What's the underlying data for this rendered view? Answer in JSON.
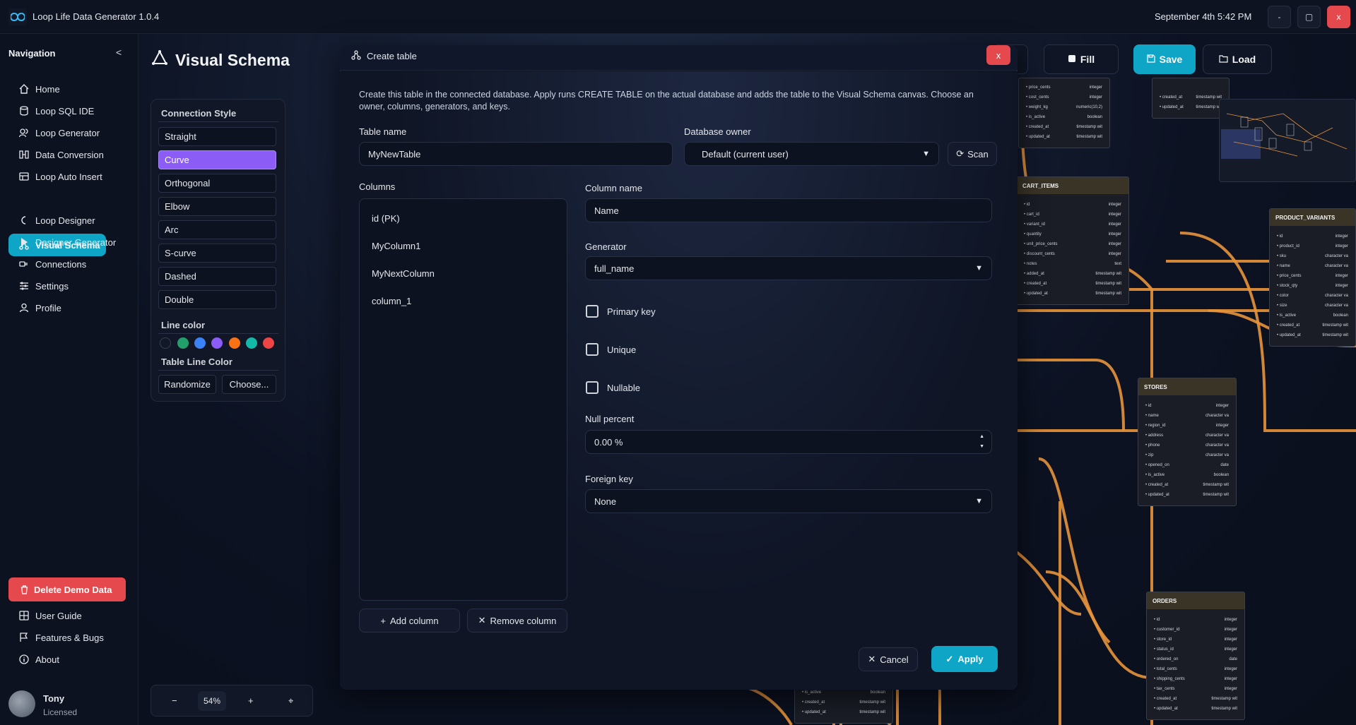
{
  "window": {
    "title": "Loop Life Data Generator 1.0.4",
    "datetime": "September 4th 5:42 PM",
    "min_label": "-",
    "max_label": "▢",
    "close_label": "x"
  },
  "sidebar": {
    "heading": "Navigation",
    "collapse_label": "<",
    "items": [
      {
        "label": "Home",
        "icon": "home-icon"
      },
      {
        "label": "Loop SQL IDE",
        "icon": "database-icon"
      },
      {
        "label": "Loop Generator",
        "icon": "users-icon"
      },
      {
        "label": "Data Conversion",
        "icon": "convert-icon"
      },
      {
        "label": "Loop Auto Insert",
        "icon": "insert-icon"
      },
      {
        "label": "Visual Schema",
        "icon": "schema-icon"
      },
      {
        "label": "Loop Designer",
        "icon": "designer-icon"
      },
      {
        "label": "Designer Generator",
        "icon": "play-icon"
      },
      {
        "label": "Connections",
        "icon": "plug-icon"
      },
      {
        "label": "Settings",
        "icon": "sliders-icon"
      },
      {
        "label": "Profile",
        "icon": "user-icon"
      }
    ],
    "delete_demo": "Delete Demo Data",
    "bottom_items": [
      {
        "label": "User Guide",
        "icon": "book-icon"
      },
      {
        "label": "Features & Bugs",
        "icon": "flag-icon"
      },
      {
        "label": "About",
        "icon": "info-icon"
      }
    ],
    "user": {
      "name": "Tony",
      "status": "Licensed"
    }
  },
  "header": {
    "title": "Visual Schema",
    "fill_label": "Fill",
    "save_label": "Save",
    "load_label": "Load"
  },
  "style_panel": {
    "connection_heading": "Connection Style",
    "options": [
      "Straight",
      "Curve",
      "Orthogonal",
      "Elbow",
      "Arc",
      "S-curve",
      "Dashed",
      "Double"
    ],
    "selected": "Curve",
    "line_color_heading": "Line color",
    "colors": [
      "#111827",
      "#22a06b",
      "#3b82f6",
      "#8b5cf6",
      "#f97316",
      "#14b8a6",
      "#ef4444"
    ],
    "table_line_heading": "Table Line Color",
    "randomize_label": "Randomize",
    "choose_label": "Choose..."
  },
  "zoom": {
    "minus": "−",
    "value": "54%",
    "plus": "+",
    "reset": "⌖"
  },
  "canvas": {
    "tables": [
      {
        "name": "",
        "rows": [
          [
            "price_cents",
            "integer"
          ],
          [
            "cost_cents",
            "integer"
          ],
          [
            "weight_kg",
            "numeric(10,2)"
          ],
          [
            "is_active",
            "boolean"
          ],
          [
            "created_at",
            "timestamp wit"
          ],
          [
            "updated_at",
            "timestamp wit"
          ]
        ]
      },
      {
        "name": "",
        "rows": [
          [
            "created_at",
            "timestamp wit"
          ],
          [
            "updated_at",
            "timestamp wit"
          ]
        ]
      },
      {
        "name": "CART_ITEMS",
        "rows": [
          [
            "id",
            "integer"
          ],
          [
            "cart_id",
            "integer"
          ],
          [
            "variant_id",
            "integer"
          ],
          [
            "quantity",
            "integer"
          ],
          [
            "unit_price_cents",
            "integer"
          ],
          [
            "discount_cents",
            "integer"
          ],
          [
            "notes",
            "text"
          ],
          [
            "added_at",
            "timestamp wit"
          ],
          [
            "created_at",
            "timestamp wit"
          ],
          [
            "updated_at",
            "timestamp wit"
          ]
        ]
      },
      {
        "name": "PRODUCT_VARIANTS",
        "rows": [
          [
            "id",
            "integer"
          ],
          [
            "product_id",
            "integer"
          ],
          [
            "sku",
            "character va"
          ],
          [
            "name",
            "character va"
          ],
          [
            "price_cents",
            "integer"
          ],
          [
            "stock_qty",
            "integer"
          ],
          [
            "color",
            "character va"
          ],
          [
            "size",
            "character va"
          ],
          [
            "is_active",
            "boolean"
          ],
          [
            "created_at",
            "timestamp wit"
          ],
          [
            "updated_at",
            "timestamp wit"
          ]
        ]
      },
      {
        "name": "STORES",
        "rows": [
          [
            "id",
            "integer"
          ],
          [
            "name",
            "character va"
          ],
          [
            "region_id",
            "integer"
          ],
          [
            "address",
            "character va"
          ],
          [
            "phone",
            "character va"
          ],
          [
            "zip",
            "character va"
          ],
          [
            "opened_on",
            "date"
          ],
          [
            "is_active",
            "boolean"
          ],
          [
            "created_at",
            "timestamp wit"
          ],
          [
            "updated_at",
            "timestamp wit"
          ]
        ]
      },
      {
        "name": "ORDERS",
        "rows": [
          [
            "id",
            "integer"
          ],
          [
            "customer_id",
            "integer"
          ],
          [
            "store_id",
            "integer"
          ],
          [
            "status_id",
            "integer"
          ],
          [
            "ordered_on",
            "date"
          ],
          [
            "total_cents",
            "integer"
          ],
          [
            "shipping_cents",
            "integer"
          ],
          [
            "tax_cents",
            "integer"
          ],
          [
            "created_at",
            "timestamp wit"
          ],
          [
            "updated_at",
            "timestamp wit"
          ]
        ]
      },
      {
        "name": "",
        "rows": [
          [
            "is_active",
            "boolean"
          ],
          [
            "created_at",
            "timestamp wit"
          ],
          [
            "updated_at",
            "timestamp wit"
          ]
        ]
      }
    ],
    "line_color": "#e8943a"
  },
  "modal": {
    "title": "Create table",
    "close_label": "x",
    "description": "Create this table in the connected database. Apply runs CREATE TABLE on the actual database and adds the table to the Visual Schema canvas. Choose an owner, columns, generators, and keys.",
    "table_name_label": "Table name",
    "table_name_value": "MyNewTable",
    "owner_label": "Database owner",
    "owner_value": "Default (current user)",
    "scan_label": "Scan",
    "columns_label": "Columns",
    "columns": [
      "id (PK)",
      "MyColumn1",
      "MyNextColumn",
      "column_1"
    ],
    "column_name_label": "Column name",
    "column_name_value": "Name",
    "generator_label": "Generator",
    "generator_value": "full_name",
    "primary_key_label": "Primary key",
    "unique_label": "Unique",
    "nullable_label": "Nullable",
    "null_percent_label": "Null percent",
    "null_percent_value": "0.00 %",
    "foreign_key_label": "Foreign key",
    "foreign_key_value": "None",
    "add_column_label": "Add column",
    "remove_column_label": "Remove column",
    "cancel_label": "Cancel",
    "apply_label": "Apply"
  }
}
